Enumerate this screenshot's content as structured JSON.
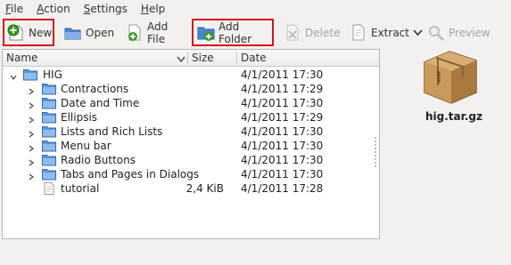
{
  "menu": {
    "items": [
      {
        "first": "F",
        "rest": "ile"
      },
      {
        "first": "A",
        "rest": "ction"
      },
      {
        "first": "S",
        "rest": "ettings"
      },
      {
        "first": "H",
        "rest": "elp"
      }
    ]
  },
  "toolbar": {
    "new_label": "New",
    "open_label": "Open",
    "add_file_label": "Add File",
    "add_folder_label": "Add Folder",
    "delete_label": "Delete",
    "extract_label": "Extract",
    "preview_label": "Preview",
    "highlight_color": "#d4141e"
  },
  "filelist": {
    "columns": {
      "name": "Name",
      "size": "Size",
      "date": "Date"
    },
    "root": {
      "name": "HIG",
      "date": "4/1/2011 17:30"
    },
    "rows": [
      {
        "name": "Contractions",
        "size": "",
        "date": "4/1/2011 17:29",
        "type": "folder"
      },
      {
        "name": "Date and Time",
        "size": "",
        "date": "4/1/2011 17:30",
        "type": "folder"
      },
      {
        "name": "Ellipsis",
        "size": "",
        "date": "4/1/2011 17:29",
        "type": "folder"
      },
      {
        "name": "Lists and Rich Lists",
        "size": "",
        "date": "4/1/2011 17:30",
        "type": "folder"
      },
      {
        "name": "Menu bar",
        "size": "",
        "date": "4/1/2011 17:30",
        "type": "folder"
      },
      {
        "name": "Radio Buttons",
        "size": "",
        "date": "4/1/2011 17:30",
        "type": "folder"
      },
      {
        "name": "Tabs and Pages in Dialogs",
        "size": "",
        "date": "4/1/2011 17:30",
        "type": "folder"
      },
      {
        "name": "tutorial",
        "size": "2,4 KiB",
        "date": "4/1/2011 17:28",
        "type": "file"
      }
    ]
  },
  "desktop": {
    "archive_label": "hig.tar.gz"
  }
}
